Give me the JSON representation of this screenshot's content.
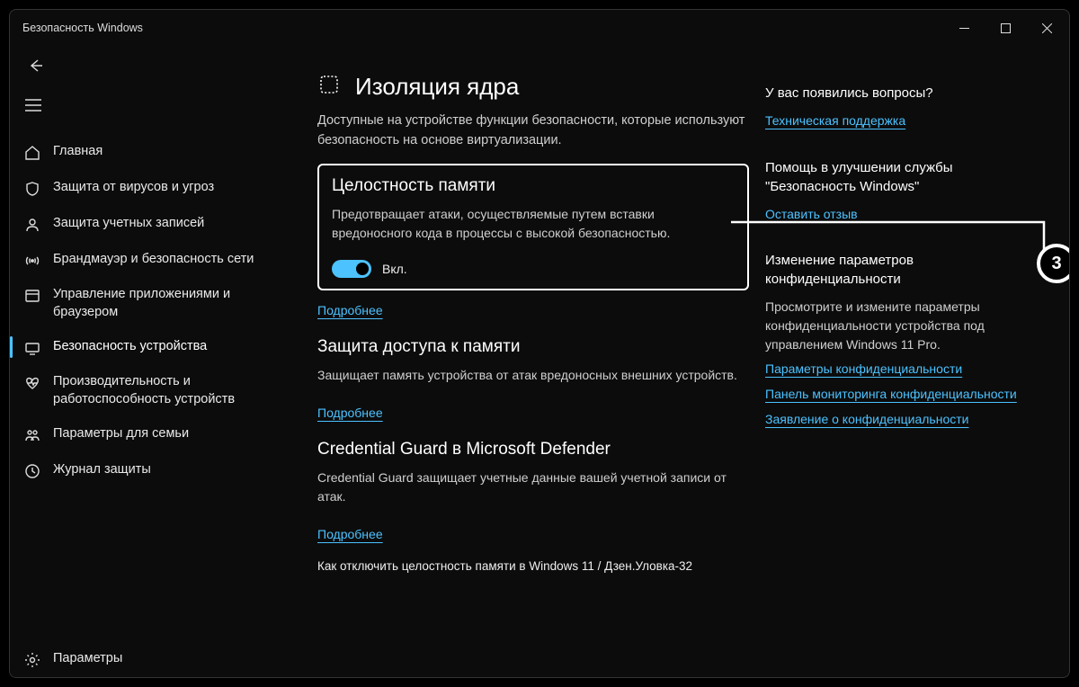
{
  "window": {
    "title": "Безопасность Windows"
  },
  "sidebar": {
    "items": [
      {
        "label": "Главная"
      },
      {
        "label": "Защита от вирусов и угроз"
      },
      {
        "label": "Защита учетных записей"
      },
      {
        "label": "Брандмауэр и безопасность сети"
      },
      {
        "label": "Управление приложениями и браузером"
      },
      {
        "label": "Безопасность устройства"
      },
      {
        "label": "Производительность и работоспособность устройств"
      },
      {
        "label": "Параметры для семьи"
      },
      {
        "label": "Журнал защиты"
      }
    ],
    "footer": {
      "label": "Параметры"
    }
  },
  "page": {
    "title": "Изоляция ядра",
    "description": "Доступные на устройстве функции безопасности, которые используют безопасность на основе виртуализации."
  },
  "memory_integrity": {
    "title": "Целостность памяти",
    "description": "Предотвращает атаки, осуществляемые путем вставки вредоносного кода в процессы с высокой безопасностью.",
    "toggle_label": "Вкл.",
    "learn_more": "Подробнее"
  },
  "memory_access": {
    "title": "Защита доступа к памяти",
    "description": "Защищает память устройства от атак вредоносных внешних устройств.",
    "learn_more": "Подробнее"
  },
  "credential_guard": {
    "title": "Credential Guard в Microsoft Defender",
    "description": "Credential Guard защищает учетные данные вашей учетной записи от атак.",
    "learn_more": "Подробнее"
  },
  "footer_note": "Как отключить целостность памяти в Windows 11 / Дзен.Уловка-32",
  "aside": {
    "questions": {
      "title": "У вас появились вопросы?",
      "link": "Техническая поддержка"
    },
    "improve": {
      "title": "Помощь в улучшении службы \"Безопасность Windows\"",
      "link": "Оставить отзыв"
    },
    "privacy": {
      "title": "Изменение параметров конфиденциальности",
      "desc": "Просмотрите и измените параметры конфиденциальности устройства под управлением Windows 11 Pro.",
      "links": [
        "Параметры конфиденциальности",
        "Панель мониторинга конфиденциальности",
        "Заявление о конфиденциальности"
      ]
    }
  },
  "callout": {
    "number": "3"
  }
}
